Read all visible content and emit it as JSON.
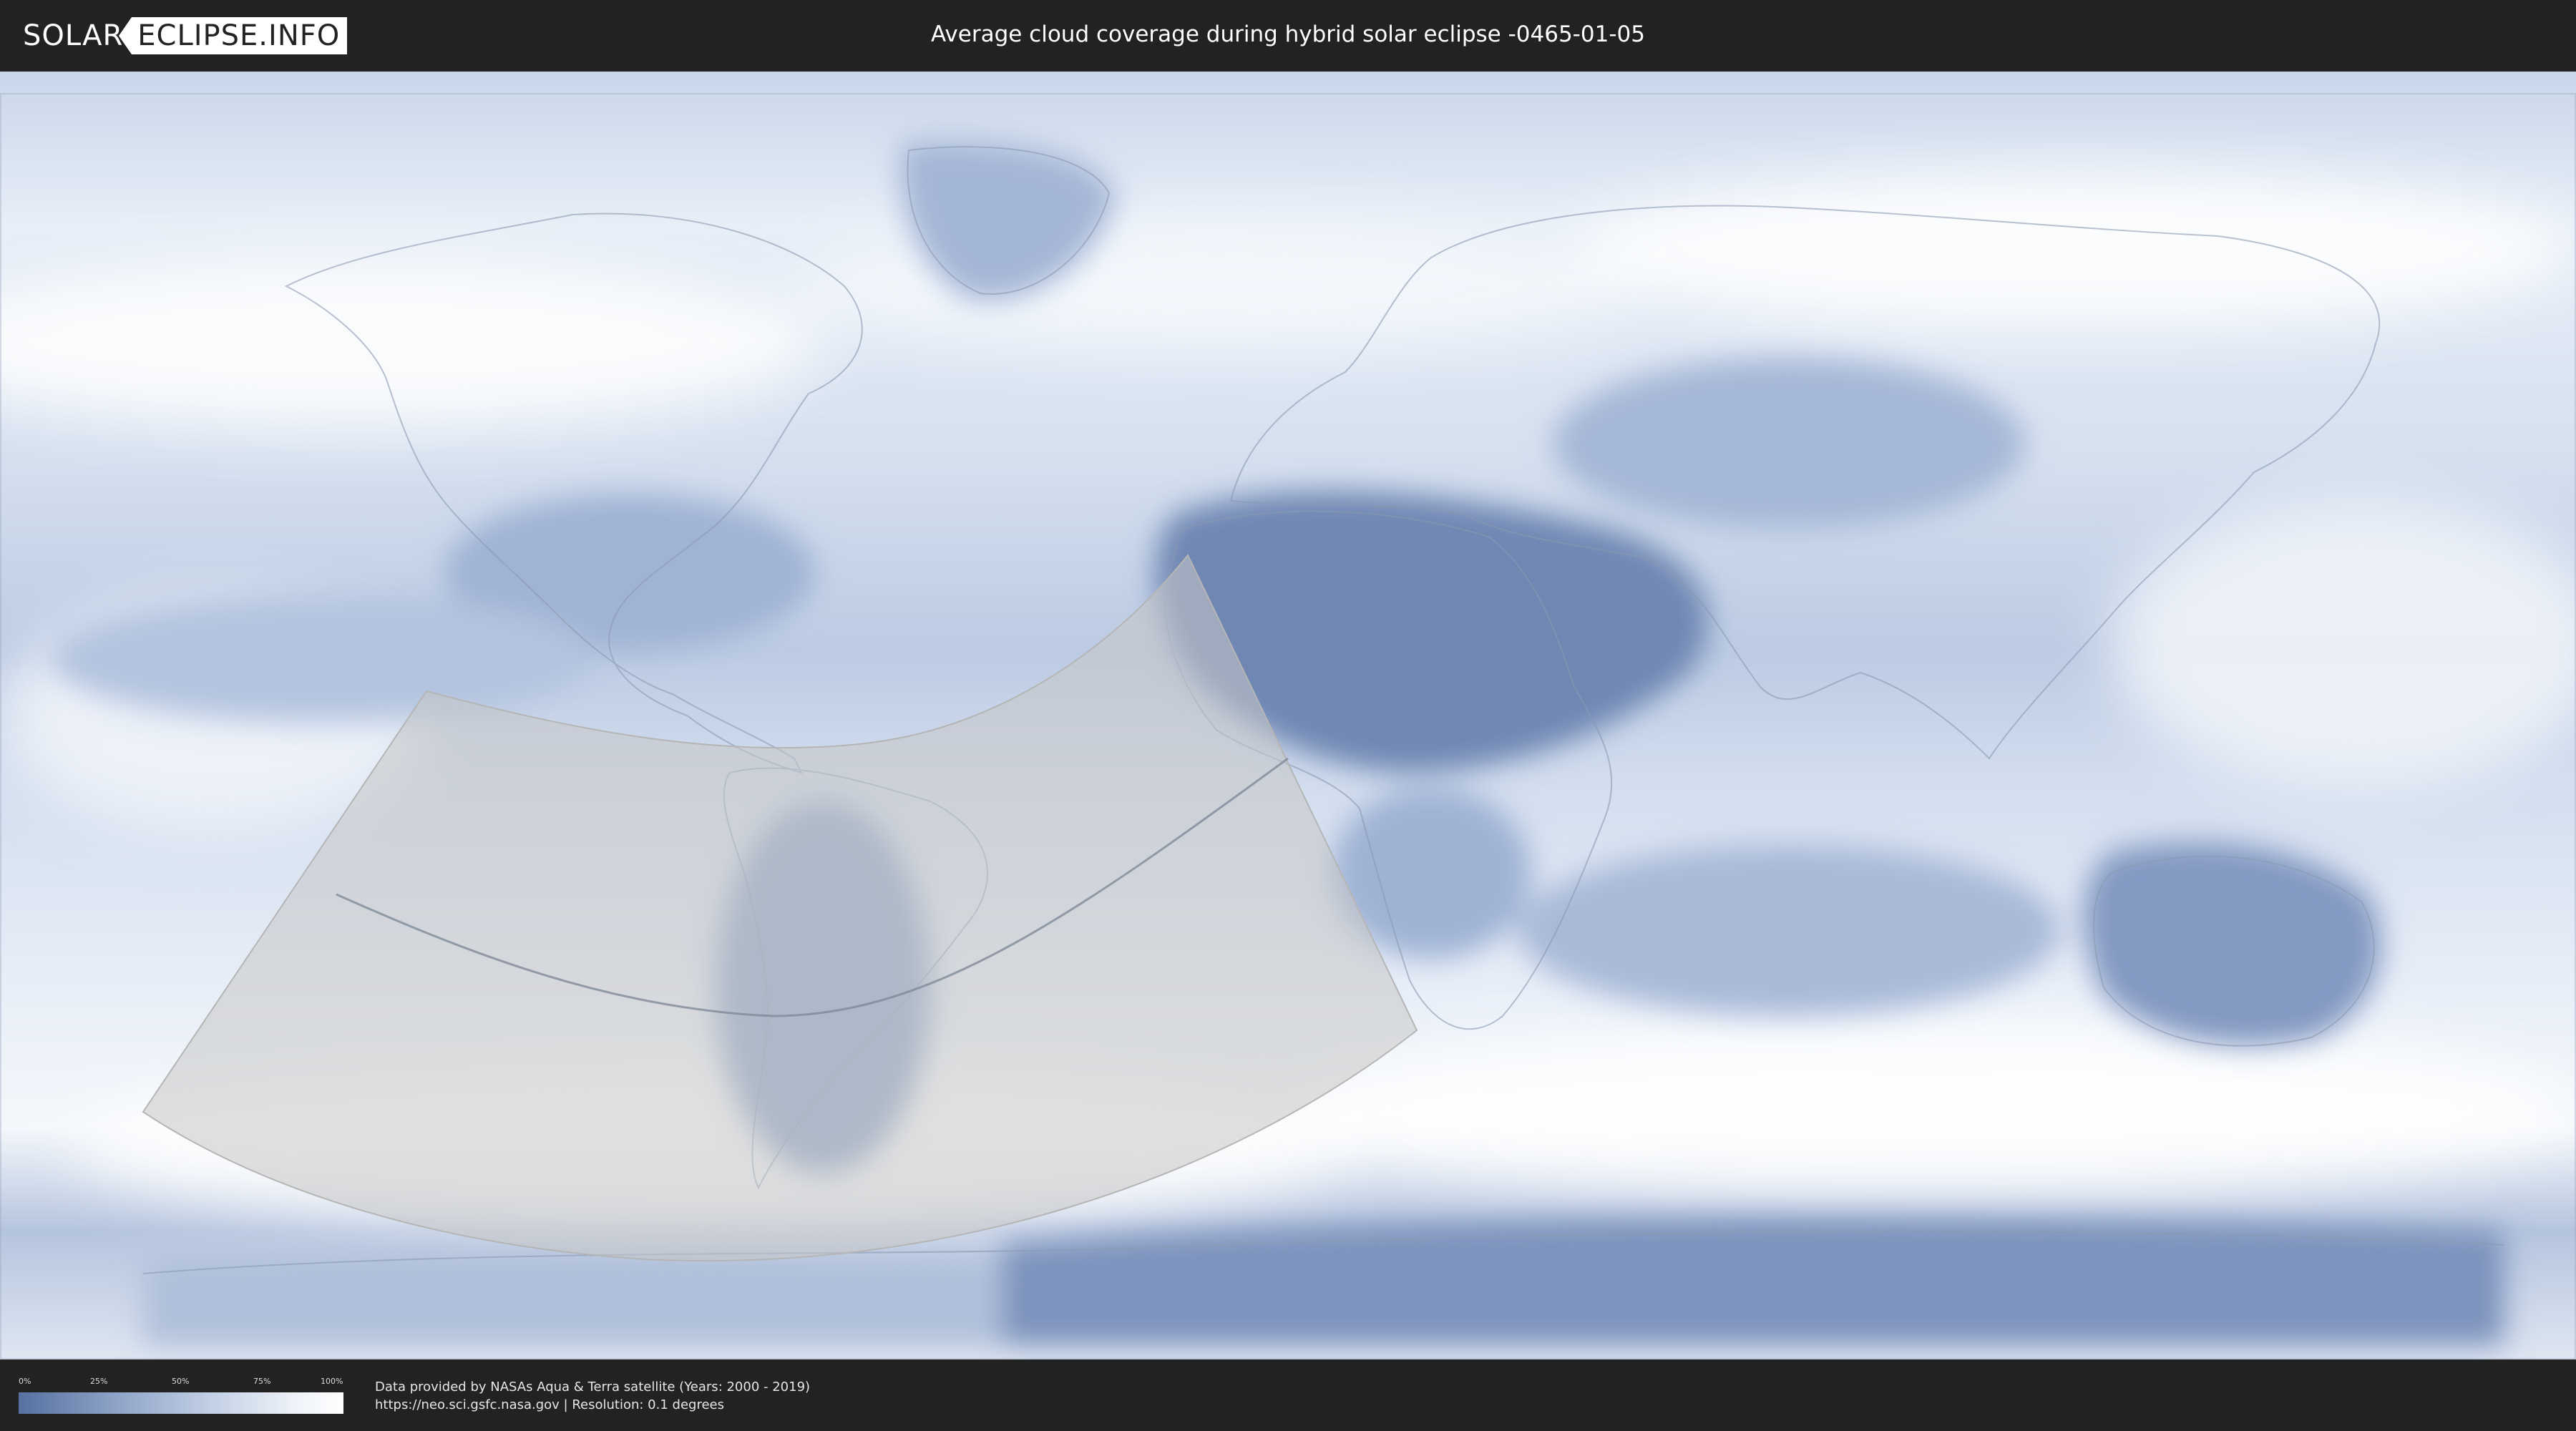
{
  "header": {
    "logo_part1": "SOLAR",
    "logo_part2": "ECLIPSE.INFO",
    "title": "Average cloud coverage during hybrid solar eclipse -0465-01-05"
  },
  "legend": {
    "ticks": [
      "0%",
      "25%",
      "50%",
      "75%",
      "100%"
    ],
    "colors": {
      "low": "#5670a0",
      "high": "#ffffff"
    }
  },
  "credits": {
    "line1": "Data provided by NASAs Aqua & Terra satellite (Years: 2000 - 2019)",
    "line2": "https://neo.sci.gsfc.nasa.gov | Resolution: 0.1 degrees"
  },
  "colors": {
    "background": "#222222",
    "ocean_cloud": "#dde6f2",
    "clear_sky": "#7f95c0",
    "eclipse_overlay": "#cfcfcf",
    "central_line": "#7f8a99"
  }
}
